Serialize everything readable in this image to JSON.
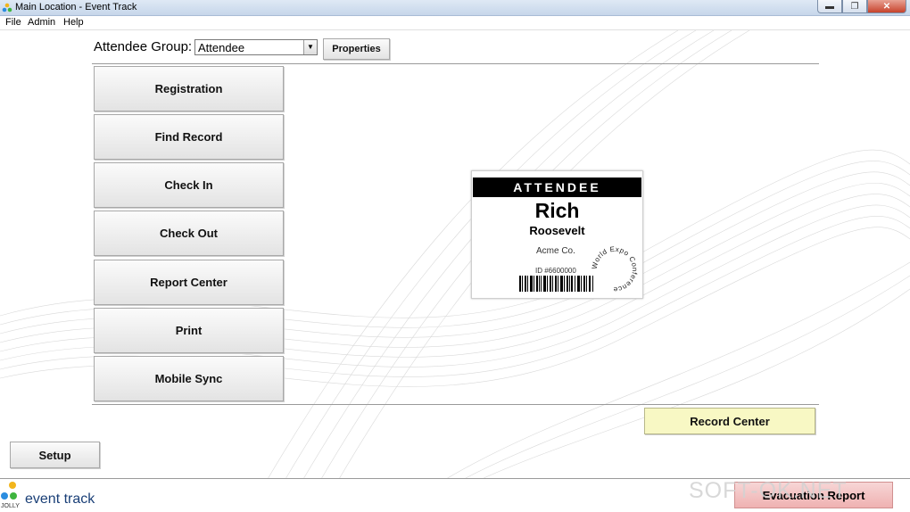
{
  "window": {
    "title": "Main Location - Event Track",
    "buttons": {
      "minimize": "▬",
      "maximize": "❐",
      "close": "✕"
    }
  },
  "menu": {
    "items": [
      "File",
      "Admin",
      "Help"
    ]
  },
  "attendee_group": {
    "label": "Attendee Group:",
    "value": "Attendee",
    "properties_label": "Properties"
  },
  "nav": {
    "buttons": [
      "Registration",
      "Find Record",
      "Check In",
      "Check Out",
      "Report Center",
      "Print",
      "Mobile Sync"
    ]
  },
  "badge": {
    "header": "ATTENDEE",
    "first_name": "Rich",
    "last_name": "Roosevelt",
    "company": "Acme Co.",
    "id": "ID #6600000",
    "seal_text": "World Expo Conference"
  },
  "record_center": {
    "label": "Record Center",
    "color": "#f8f8c4"
  },
  "setup": {
    "label": "Setup"
  },
  "footer": {
    "brand": "event track",
    "maker": "JOLLY",
    "evacuation_label": "Evacuation Report",
    "watermark": "SOFT-OK.NET"
  },
  "colors": {
    "titlebar": "#c6d6ea",
    "badge_header": "#000000",
    "evac": "#efb1b1"
  }
}
